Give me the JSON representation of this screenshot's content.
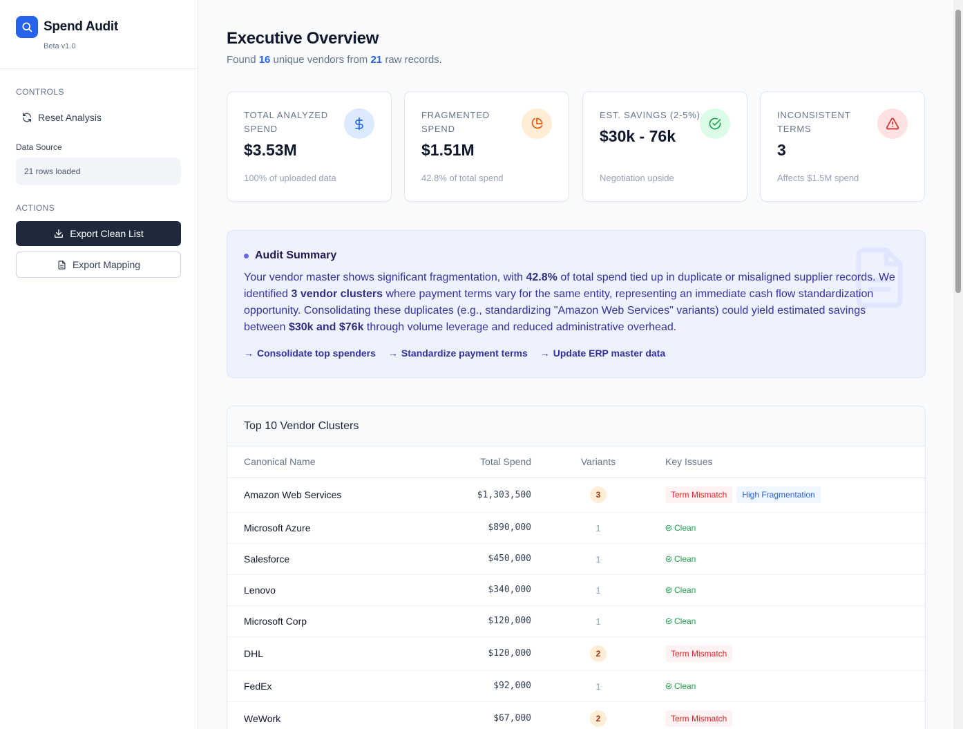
{
  "brand": {
    "title": "Spend Audit",
    "version": "Beta v1.0"
  },
  "sidebar": {
    "controls_label": "CONTROLS",
    "reset_label": "Reset Analysis",
    "data_source_label": "Data Source",
    "data_source_value": "21 rows loaded",
    "actions_label": "ACTIONS",
    "export_clean_label": "Export Clean List",
    "export_mapping_label": "Export Mapping"
  },
  "header": {
    "title": "Executive Overview",
    "sub_prefix": "Found ",
    "vendor_count": "16",
    "sub_mid": " unique vendors from ",
    "record_count": "21",
    "sub_suffix": " raw records."
  },
  "cards": [
    {
      "label": "TOTAL ANALYZED SPEND",
      "value": "$3.53M",
      "foot": "100% of uploaded data",
      "icon": "dollar-icon",
      "icon_bg": "#dbeafe",
      "icon_color": "#2563eb"
    },
    {
      "label": "FRAGMENTED SPEND",
      "value": "$1.51M",
      "foot": "42.8% of total spend",
      "icon": "pie-chart-icon",
      "icon_bg": "#ffedd5",
      "icon_color": "#ea580c"
    },
    {
      "label": "EST. SAVINGS (2-5%)",
      "value": "$30k - 76k",
      "foot": "Negotiation upside",
      "icon": "check-circle-icon",
      "icon_bg": "#dcfce7",
      "icon_color": "#16a34a"
    },
    {
      "label": "INCONSISTENT TERMS",
      "value": "3",
      "foot": "Affects $1.5M spend",
      "icon": "alert-triangle-icon",
      "icon_bg": "#fee2e2",
      "icon_color": "#dc2626"
    }
  ],
  "summary": {
    "title": "Audit Summary",
    "t1": "Your vendor master shows significant fragmentation, with ",
    "b1": "42.8%",
    "t2": " of total spend tied up in duplicate or misaligned supplier records. We identified ",
    "b2": "3 vendor clusters",
    "t3": " where payment terms vary for the same entity, representing an immediate cash flow standardization opportunity. Consolidating these duplicates (e.g., standardizing \"Amazon Web Services\" variants) could yield estimated savings between ",
    "b3": "$30k and $76k",
    "t4": " through volume leverage and reduced administrative overhead.",
    "links": [
      "Consolidate top spenders",
      "Standardize payment terms",
      "Update ERP master data"
    ]
  },
  "table": {
    "title": "Top 10 Vendor Clusters",
    "columns": [
      "Canonical Name",
      "Total Spend",
      "Variants",
      "Key Issues"
    ],
    "rows": [
      {
        "name": "Amazon Web Services",
        "spend": "$1,303,500",
        "variants": "3",
        "issues": [
          "Term Mismatch",
          "High Fragmentation"
        ]
      },
      {
        "name": "Microsoft Azure",
        "spend": "$890,000",
        "variants": "1",
        "issues": [
          "Clean"
        ]
      },
      {
        "name": "Salesforce",
        "spend": "$450,000",
        "variants": "1",
        "issues": [
          "Clean"
        ]
      },
      {
        "name": "Lenovo",
        "spend": "$340,000",
        "variants": "1",
        "issues": [
          "Clean"
        ]
      },
      {
        "name": "Microsoft Corp",
        "spend": "$120,000",
        "variants": "1",
        "issues": [
          "Clean"
        ]
      },
      {
        "name": "DHL",
        "spend": "$120,000",
        "variants": "2",
        "issues": [
          "Term Mismatch"
        ]
      },
      {
        "name": "FedEx",
        "spend": "$92,000",
        "variants": "1",
        "issues": [
          "Clean"
        ]
      },
      {
        "name": "WeWork",
        "spend": "$67,000",
        "variants": "2",
        "issues": [
          "Term Mismatch"
        ]
      }
    ]
  }
}
